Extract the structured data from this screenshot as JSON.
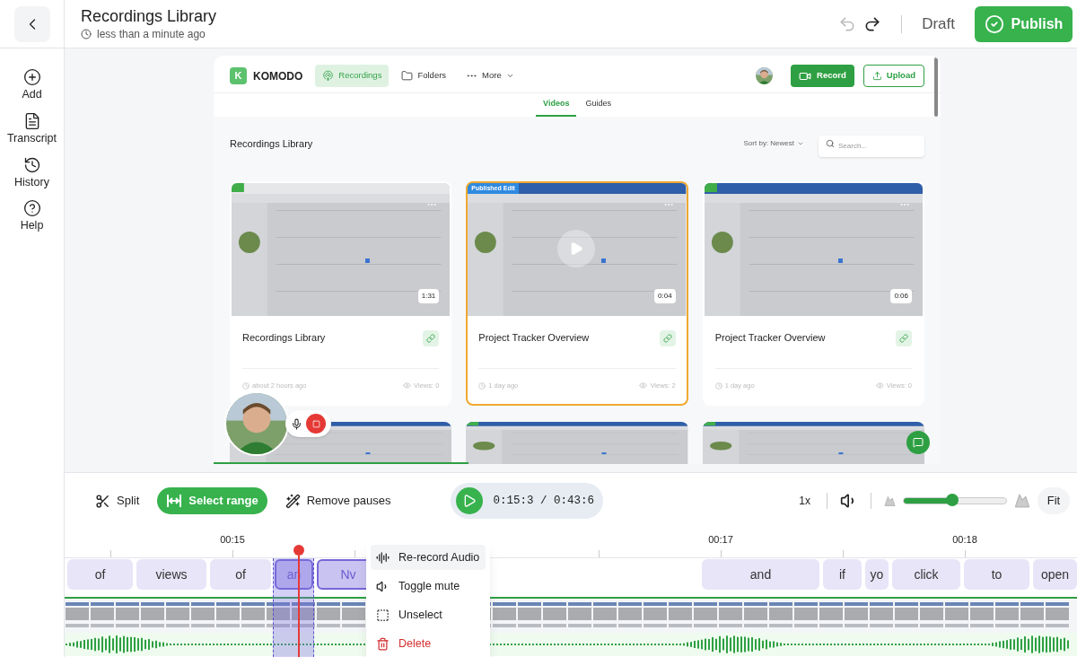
{
  "header": {
    "title": "Recordings Library",
    "subtitle": "less than a minute ago",
    "undo": {
      "disabled": true
    },
    "redo": {
      "disabled": false
    },
    "status": "Draft",
    "publish": "Publish"
  },
  "sidebar": {
    "items": [
      {
        "label": "Add",
        "kind": "add"
      },
      {
        "label": "Transcript",
        "kind": "transcript"
      },
      {
        "label": "History",
        "kind": "history"
      },
      {
        "label": "Help",
        "kind": "help"
      }
    ]
  },
  "preview": {
    "logo": "K",
    "brand": "KOMODO",
    "nav": [
      {
        "label": "Recordings",
        "kind": "recordings",
        "selected": true
      },
      {
        "label": "Folders",
        "kind": "folders",
        "selected": false
      },
      {
        "label": "More",
        "kind": "more",
        "selected": false
      }
    ],
    "record": "Record",
    "upload": "Upload",
    "tabs": [
      {
        "label": "Videos",
        "selected": true
      },
      {
        "label": "Guides",
        "selected": false
      }
    ],
    "section_title": "Recordings Library",
    "sort": "Sort by: Newest",
    "search": {
      "placeholder": "Search..."
    },
    "cards": [
      {
        "title": "Recordings Library",
        "duration": "1:31",
        "time": "about 2 hours ago",
        "views": "Views: 0",
        "selected": false
      },
      {
        "title": "Project Tracker Overview",
        "duration": "0:04",
        "time": "1 day ago",
        "views": "Views: 2",
        "badge": "Published Edit",
        "selected": true
      },
      {
        "title": "Project Tracker Overview",
        "duration": "0:06",
        "time": "1 day ago",
        "views": "Views: 0",
        "selected": false
      }
    ],
    "progress": {
      "level": 0.35
    }
  },
  "timeline": {
    "tools": [
      {
        "label": "Split",
        "kind": "split",
        "selected": false
      },
      {
        "label": "Select range",
        "kind": "range",
        "selected": true
      },
      {
        "label": "Remove pauses",
        "kind": "pauses",
        "selected": false
      }
    ],
    "time": "0:15:3 / 0:43:6",
    "speed": "1x",
    "zoom": {
      "level": 0.47
    },
    "fit": "Fit",
    "ruler": [
      "00:15",
      "00:17",
      "00:18"
    ],
    "words": [
      {
        "text": "of",
        "selected": false
      },
      {
        "text": "views",
        "selected": false
      },
      {
        "text": "of",
        "selected": false
      },
      {
        "text": "an",
        "selected": true
      },
      {
        "text": "Nv",
        "selected": true
      },
      {
        "text": "and",
        "selected": false
      },
      {
        "text": "if",
        "selected": false
      },
      {
        "text": "yo",
        "selected": false
      },
      {
        "text": "click",
        "selected": false
      },
      {
        "text": "to",
        "selected": false
      },
      {
        "text": "open",
        "selected": false
      }
    ],
    "menu": [
      {
        "label": "Re-record Audio",
        "kind": "rerecord",
        "selected": true
      },
      {
        "label": "Toggle mute",
        "kind": "mute",
        "selected": false
      },
      {
        "label": "Unselect",
        "kind": "unselect",
        "selected": false
      },
      {
        "label": "Delete",
        "kind": "delete",
        "selected": false
      }
    ]
  }
}
